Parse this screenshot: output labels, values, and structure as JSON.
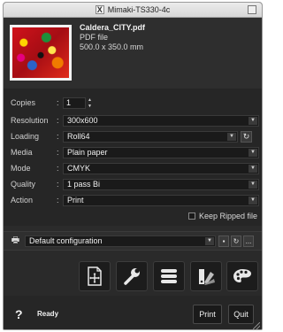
{
  "window": {
    "title": "Mimaki-TS330-4c"
  },
  "file": {
    "name": "Caldera_CITY.pdf",
    "type": "PDF file",
    "size": "500.0 x 350.0 mm"
  },
  "settings": {
    "copies": {
      "label": "Copies",
      "value": "1"
    },
    "resolution": {
      "label": "Resolution",
      "value": "300x600"
    },
    "loading": {
      "label": "Loading",
      "value": "Roll64"
    },
    "media": {
      "label": "Media",
      "value": "Plain paper"
    },
    "mode": {
      "label": "Mode",
      "value": "CMYK"
    },
    "quality": {
      "label": "Quality",
      "value": "1 pass Bi"
    },
    "action": {
      "label": "Action",
      "value": "Print"
    },
    "colon": ":"
  },
  "keep_ripped": {
    "label": "Keep Ripped file",
    "checked": false
  },
  "configuration": {
    "value": "Default configuration",
    "more_label": "..."
  },
  "tools": [
    "move-layout-icon",
    "wrench-icon",
    "list-icon",
    "color-swatches-icon",
    "palette-icon"
  ],
  "footer": {
    "help": "?",
    "status": "Ready",
    "print_label": "Print",
    "quit_label": "Quit"
  }
}
